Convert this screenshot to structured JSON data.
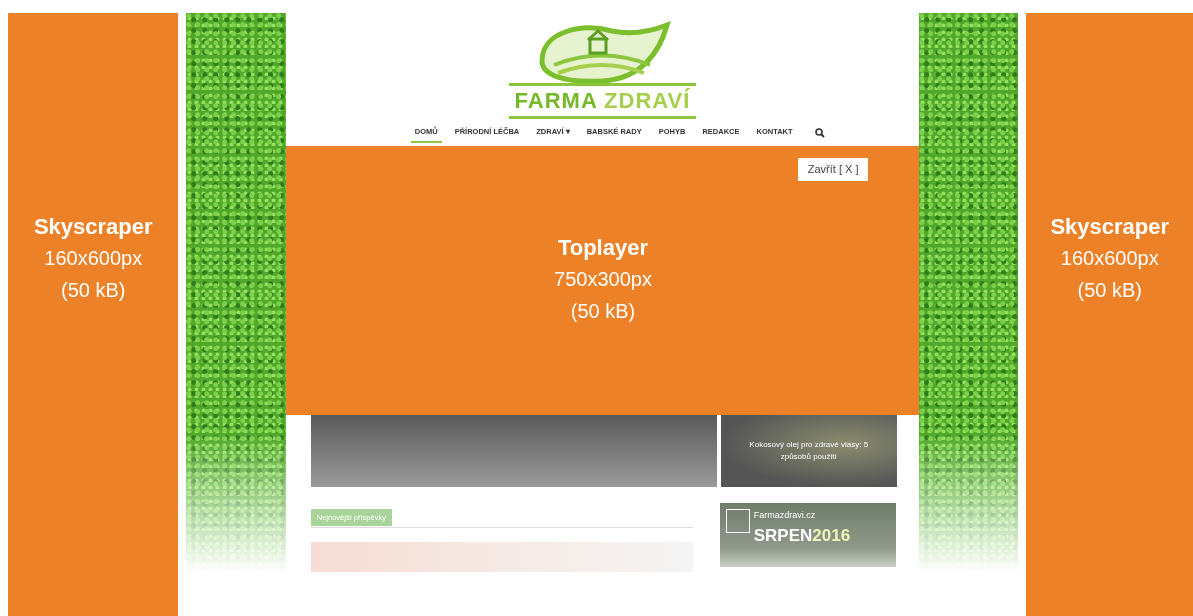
{
  "skyscraper_left": {
    "title": "Skyscraper",
    "size": "160x600px",
    "weight": "(50 kB)"
  },
  "site": {
    "logo_text_1": "FARMA",
    "logo_text_2": "ZDRAVÍ",
    "nav": [
      {
        "label": "DOMŮ",
        "selected": true
      },
      {
        "label": "PŘÍRODNÍ LÉČBA",
        "selected": false
      },
      {
        "label": "ZDRAVÍ ▾",
        "selected": false
      },
      {
        "label": "BABSKÉ RADY",
        "selected": false
      },
      {
        "label": "POHYB",
        "selected": false
      },
      {
        "label": "REDAKCE",
        "selected": false
      },
      {
        "label": "KONTAKT",
        "selected": false
      }
    ],
    "side_article": "Kokosový olej pro zdravé vlasy: 5 způsobů použití",
    "section_tag": "Nejnovější příspěvky",
    "banner": {
      "site": "Farmazdravi.cz",
      "month": "SRPEN",
      "year": "2016"
    }
  },
  "toplayer": {
    "title": "Toplayer",
    "size": "750x300px",
    "weight": "(50 kB)",
    "close": "Zavřít [ X ]"
  },
  "skyscraper_right": {
    "title": "Skyscraper",
    "size": "160x600px",
    "weight": "(50 kB)"
  }
}
